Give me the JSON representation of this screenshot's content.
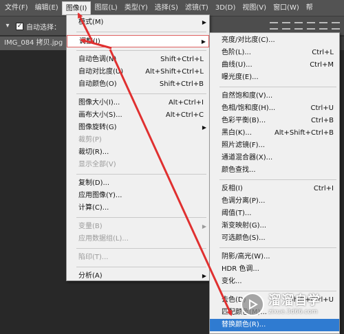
{
  "menubar": {
    "items": [
      {
        "label": "文件(F)"
      },
      {
        "label": "编辑(E)"
      },
      {
        "label": "图像(I)"
      },
      {
        "label": "图层(L)"
      },
      {
        "label": "类型(Y)"
      },
      {
        "label": "选择(S)"
      },
      {
        "label": "滤镜(T)"
      },
      {
        "label": "3D(D)"
      },
      {
        "label": "视图(V)"
      },
      {
        "label": "窗口(W)"
      },
      {
        "label": "帮"
      }
    ]
  },
  "options_bar": {
    "auto_select_label": "自动选择：",
    "auto_select_checked": true
  },
  "document": {
    "tab_title": "IMG_084 拷贝.jpg"
  },
  "image_menu": {
    "items": [
      {
        "label": "模式(M)",
        "shortcut": "",
        "submenu": true
      },
      {
        "label": "调整(J)",
        "shortcut": "",
        "submenu": true,
        "highlighted": true
      },
      {
        "label": "自动色调(N)",
        "shortcut": "Shift+Ctrl+L"
      },
      {
        "label": "自动对比度(U)",
        "shortcut": "Alt+Shift+Ctrl+L"
      },
      {
        "label": "自动颜色(O)",
        "shortcut": "Shift+Ctrl+B"
      },
      {
        "label": "图像大小(I)...",
        "shortcut": "Alt+Ctrl+I"
      },
      {
        "label": "画布大小(S)...",
        "shortcut": "Alt+Ctrl+C"
      },
      {
        "label": "图像旋转(G)",
        "shortcut": "",
        "submenu": true
      },
      {
        "label": "裁剪(P)",
        "shortcut": "",
        "disabled": true
      },
      {
        "label": "裁切(R)...",
        "shortcut": ""
      },
      {
        "label": "显示全部(V)",
        "shortcut": "",
        "disabled": true
      },
      {
        "label": "复制(D)...",
        "shortcut": ""
      },
      {
        "label": "应用图像(Y)...",
        "shortcut": ""
      },
      {
        "label": "计算(C)...",
        "shortcut": ""
      },
      {
        "label": "变量(B)",
        "shortcut": "",
        "submenu": true,
        "disabled": true
      },
      {
        "label": "应用数据组(L)...",
        "shortcut": "",
        "disabled": true
      },
      {
        "label": "陷印(T)...",
        "shortcut": "",
        "disabled": true
      },
      {
        "label": "分析(A)",
        "shortcut": "",
        "submenu": true
      }
    ]
  },
  "adjust_menu": {
    "items": [
      {
        "label": "亮度/对比度(C)...",
        "shortcut": ""
      },
      {
        "label": "色阶(L)...",
        "shortcut": "Ctrl+L"
      },
      {
        "label": "曲线(U)...",
        "shortcut": "Ctrl+M"
      },
      {
        "label": "曝光度(E)...",
        "shortcut": ""
      },
      {
        "label": "自然饱和度(V)...",
        "shortcut": ""
      },
      {
        "label": "色相/饱和度(H)...",
        "shortcut": "Ctrl+U"
      },
      {
        "label": "色彩平衡(B)...",
        "shortcut": "Ctrl+B"
      },
      {
        "label": "黑白(K)...",
        "shortcut": "Alt+Shift+Ctrl+B"
      },
      {
        "label": "照片滤镜(F)...",
        "shortcut": ""
      },
      {
        "label": "通道混合器(X)...",
        "shortcut": ""
      },
      {
        "label": "颜色查找...",
        "shortcut": ""
      },
      {
        "label": "反相(I)",
        "shortcut": "Ctrl+I"
      },
      {
        "label": "色调分离(P)...",
        "shortcut": ""
      },
      {
        "label": "阈值(T)...",
        "shortcut": ""
      },
      {
        "label": "渐变映射(G)...",
        "shortcut": ""
      },
      {
        "label": "可选颜色(S)...",
        "shortcut": ""
      },
      {
        "label": "阴影/高光(W)...",
        "shortcut": ""
      },
      {
        "label": "HDR 色调...",
        "shortcut": ""
      },
      {
        "label": "变化...",
        "shortcut": ""
      },
      {
        "label": "去色(D)",
        "shortcut": "Shift+Ctrl+U"
      },
      {
        "label": "匹配颜色(M)...",
        "shortcut": ""
      },
      {
        "label": "替换颜色(R)...",
        "shortcut": "",
        "selected": true
      }
    ]
  },
  "watermark": {
    "title": "溜溜自学",
    "url": "zixue.3d66.com"
  },
  "colors": {
    "menubar_bg": "#535353",
    "menu_bg": "#f0f0f0",
    "selected_bg": "#2f7bd1",
    "annotation_arrow": "#e03030"
  }
}
